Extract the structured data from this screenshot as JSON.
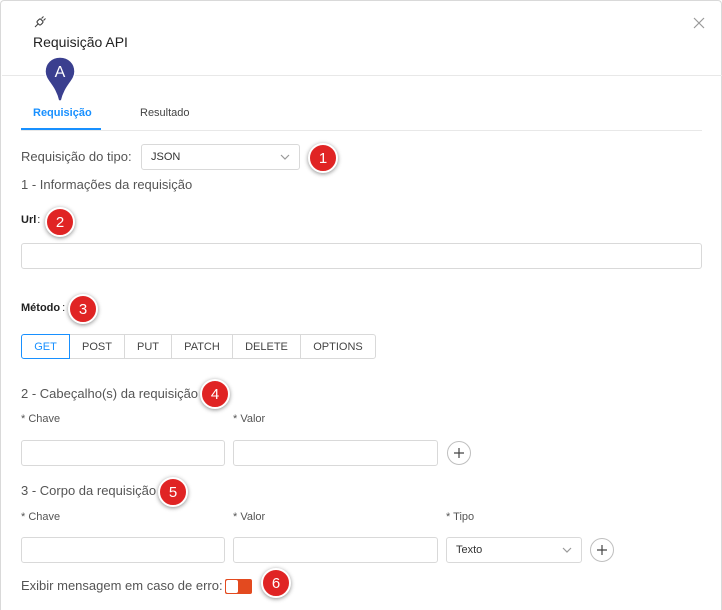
{
  "dialog": {
    "title": "Requisição API",
    "close_icon": "close-icon",
    "header_icon": "plug-icon"
  },
  "tabs": [
    {
      "label": "Requisição",
      "active": true
    },
    {
      "label": "Resultado",
      "active": false
    }
  ],
  "request_type": {
    "label": "Requisição do tipo:",
    "value": "JSON"
  },
  "section1": {
    "title": "1 - Informações da requisição"
  },
  "url": {
    "label": "Url",
    "colon": ":",
    "value": ""
  },
  "method": {
    "label": "Método",
    "colon": ":",
    "options": [
      "GET",
      "POST",
      "PUT",
      "PATCH",
      "DELETE",
      "OPTIONS"
    ],
    "selected": "GET"
  },
  "section2": {
    "title": "2 - Cabeçalho(s) da requisição",
    "key_label": "* Chave",
    "value_label": "* Valor",
    "key_value": "",
    "value_value": ""
  },
  "section3": {
    "title": "3 - Corpo da requisição",
    "key_label": "* Chave",
    "value_label": "* Valor",
    "type_label": "* Tipo",
    "type_value": "Texto",
    "key_value": "",
    "value_value": ""
  },
  "error_message": {
    "label": "Exibir mensagem em caso de erro:",
    "enabled": true
  },
  "annotations": {
    "pin": "A",
    "badges": [
      "1",
      "2",
      "3",
      "4",
      "5",
      "6"
    ]
  },
  "colors": {
    "accent": "#1890ff",
    "badge": "#e02424",
    "pin": "#3a3f8f",
    "toggle": "#e34a1f"
  }
}
